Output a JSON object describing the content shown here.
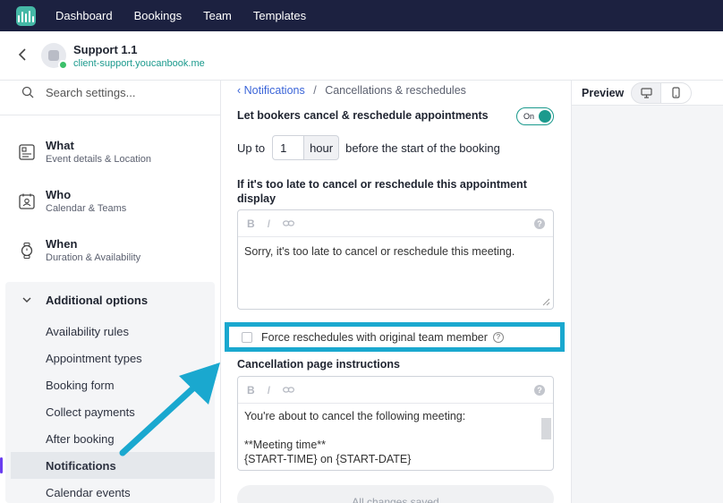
{
  "nav": {
    "items": [
      "Dashboard",
      "Bookings",
      "Team",
      "Templates"
    ]
  },
  "header": {
    "title": "Support 1.1",
    "subtitle": "client-support.youcanbook.me"
  },
  "sidebar": {
    "search_placeholder": "Search settings...",
    "sections": [
      {
        "title": "What",
        "subtitle": "Event details & Location",
        "icon": "document-icon"
      },
      {
        "title": "Who",
        "subtitle": "Calendar & Teams",
        "icon": "person-calendar-icon"
      },
      {
        "title": "When",
        "subtitle": "Duration & Availability",
        "icon": "watch-icon"
      }
    ],
    "additional": {
      "title": "Additional options",
      "items": [
        "Availability rules",
        "Appointment types",
        "Booking form",
        "Collect payments",
        "After booking",
        "Notifications",
        "Calendar events"
      ],
      "active": "Notifications"
    }
  },
  "main": {
    "breadcrumb": {
      "link": "Notifications",
      "separator": "/",
      "current": "Cancellations & reschedules"
    },
    "cancel_label": "Let bookers cancel & reschedule appointments",
    "toggle_label": "On",
    "upto": {
      "prefix": "Up to",
      "value": "1",
      "unit": "hour",
      "suffix": "before the start of the booking"
    },
    "too_late_label": "If it's too late to cancel or reschedule this appointment display",
    "too_late_text": "Sorry, it's too late to cancel or reschedule this meeting.",
    "toolbar": {
      "bold": "B",
      "italic": "I",
      "link": "⊖",
      "help": "?"
    },
    "force_label": "Force reschedules with original team member",
    "cancel_page_label": "Cancellation page instructions",
    "cancel_page_lines": [
      "You're about to cancel the following meeting:",
      "",
      "**Meeting time**",
      "{START-TIME} on {START-DATE}"
    ],
    "saved_label": "All changes saved"
  },
  "preview": {
    "title": "Preview"
  },
  "colors": {
    "accent": "#1b9a8d",
    "highlight": "#1aa8cf",
    "nav_bg": "#1c2140",
    "active_marker": "#6a3df0"
  }
}
